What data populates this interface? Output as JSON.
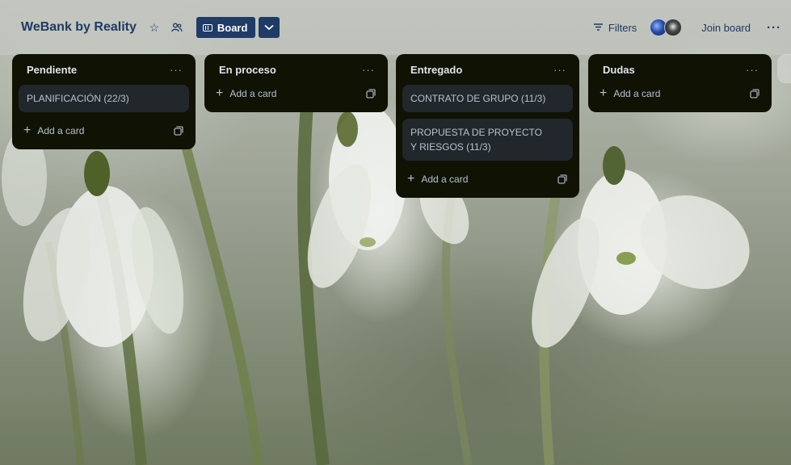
{
  "header": {
    "board_title": "WeBank by Reality",
    "star_icon": "star-icon",
    "visibility_icon": "workspace-visible-icon",
    "view_button_label": "Board",
    "view_caret_icon": "chevron-down-icon",
    "filters_label": "Filters",
    "join_board_label": "Join board",
    "more_icon": "more-horizontal-icon"
  },
  "lists": [
    {
      "title": "Pendiente",
      "cards": [
        {
          "title": "PLANIFICACIÓN (22/3)"
        }
      ],
      "add_card_label": "Add a card"
    },
    {
      "title": "En proceso",
      "cards": [],
      "add_card_label": "Add a card"
    },
    {
      "title": "Entregado",
      "cards": [
        {
          "title": "CONTRATO DE GRUPO (11/3)"
        },
        {
          "title": "PROPUESTA DE PROYECTO Y RIESGOS (11/3)"
        }
      ],
      "add_card_label": "Add a card"
    },
    {
      "title": "Dudas",
      "cards": [],
      "add_card_label": "Add a card"
    }
  ],
  "colors": {
    "list_bg": "#101204",
    "card_bg": "#22272b",
    "header_text": "#1f3a63",
    "view_button_bg": "#1f3b66"
  }
}
